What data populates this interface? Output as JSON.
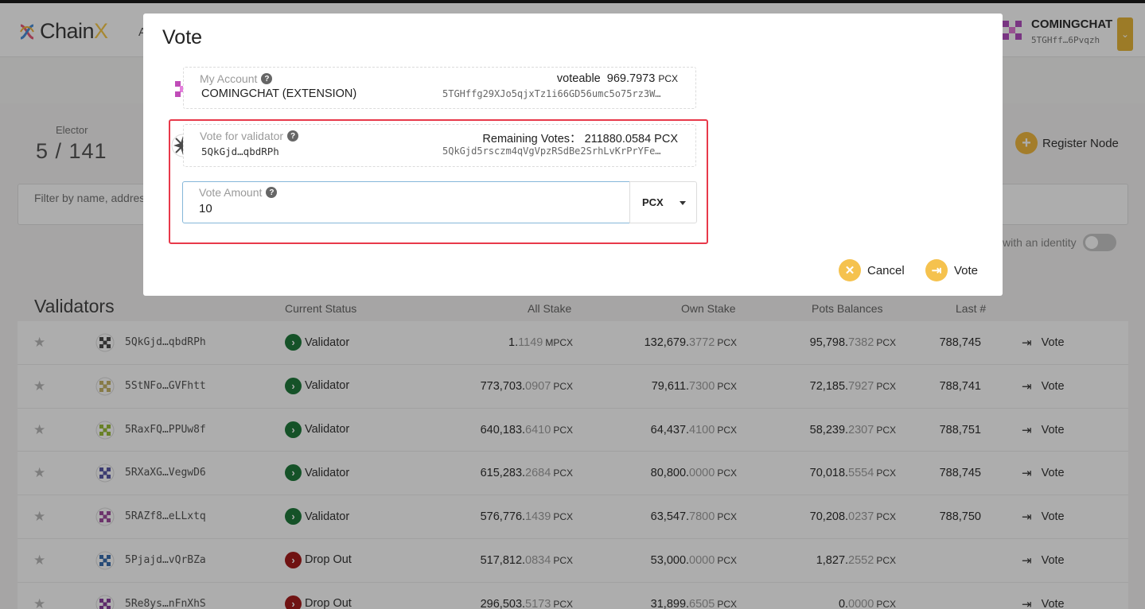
{
  "header": {
    "logo_text_a": "Chain",
    "logo_text_b": "X",
    "nav_peek": "A",
    "account_name": "COMINGCHAT",
    "account_addr": "5TGHff…6Pvqzh"
  },
  "summary": {
    "elector_label": "Elector",
    "elector_value": "5  /  141",
    "register_label": "Register Node"
  },
  "filter": {
    "placeholder": "Filter by name, address",
    "identity_label": "with an identity"
  },
  "validators": {
    "title": "Validators",
    "columns": {
      "status": "Current Status",
      "all_stake": "All Stake",
      "own_stake": "Own Stake",
      "pots": "Pots Balances",
      "last": "Last #"
    },
    "vote_label": "Vote",
    "rows": [
      {
        "name": "5QkGjd…qbdRPh",
        "status": "Validator",
        "all_int": "1.",
        "all_dec": "1149",
        "all_unit": "MPCX",
        "own_int": "132,679.",
        "own_dec": "3772",
        "own_unit": "PCX",
        "pot_int": "95,798.",
        "pot_dec": "7382",
        "pot_unit": "PCX",
        "last": "788,745"
      },
      {
        "name": "5StNFo…GVFhtt",
        "status": "Validator",
        "all_int": "773,703.",
        "all_dec": "0907",
        "all_unit": "PCX",
        "own_int": "79,611.",
        "own_dec": "7300",
        "own_unit": "PCX",
        "pot_int": "72,185.",
        "pot_dec": "7927",
        "pot_unit": "PCX",
        "last": "788,741"
      },
      {
        "name": "5RaxFQ…PPUw8f",
        "status": "Validator",
        "all_int": "640,183.",
        "all_dec": "6410",
        "all_unit": "PCX",
        "own_int": "64,437.",
        "own_dec": "4100",
        "own_unit": "PCX",
        "pot_int": "58,239.",
        "pot_dec": "2307",
        "pot_unit": "PCX",
        "last": "788,751"
      },
      {
        "name": "5RXaXG…VegwD6",
        "status": "Validator",
        "all_int": "615,283.",
        "all_dec": "2684",
        "all_unit": "PCX",
        "own_int": "80,800.",
        "own_dec": "0000",
        "own_unit": "PCX",
        "pot_int": "70,018.",
        "pot_dec": "5554",
        "pot_unit": "PCX",
        "last": "788,745"
      },
      {
        "name": "5RAZf8…eLLxtq",
        "status": "Validator",
        "all_int": "576,776.",
        "all_dec": "1439",
        "all_unit": "PCX",
        "own_int": "63,547.",
        "own_dec": "7800",
        "own_unit": "PCX",
        "pot_int": "70,208.",
        "pot_dec": "0237",
        "pot_unit": "PCX",
        "last": "788,750"
      },
      {
        "name": "5Pjajd…vQrBZa",
        "status": "Drop Out",
        "all_int": "517,812.",
        "all_dec": "0834",
        "all_unit": "PCX",
        "own_int": "53,000.",
        "own_dec": "0000",
        "own_unit": "PCX",
        "pot_int": "1,827.",
        "pot_dec": "2552",
        "pot_unit": "PCX",
        "last": ""
      },
      {
        "name": "5Re8ys…nFnXhS",
        "status": "Drop Out",
        "all_int": "296,503.",
        "all_dec": "5173",
        "all_unit": "PCX",
        "own_int": "31,899.",
        "own_dec": "6505",
        "own_unit": "PCX",
        "pot_int": "0.",
        "pot_dec": "0000",
        "pot_unit": "PCX",
        "last": ""
      }
    ]
  },
  "modal": {
    "title": "Vote",
    "account": {
      "label": "My Account",
      "name": "COMINGCHAT (EXTENSION)",
      "voteable_label": "voteable",
      "voteable_value": "969.7973",
      "voteable_unit": "PCX",
      "address": "5TGHffg29XJo5qjxTz1i66GD56umc5o75rz3W…"
    },
    "validator": {
      "label": "Vote for validator",
      "name": "5QkGjd…qbdRPh",
      "remaining_label": "Remaining Votes：",
      "remaining_value": "211880.0584 PCX",
      "address": "5QkGjd5rsczm4qVgVpzRSdBe2SrhLvKrPrYFe…"
    },
    "amount": {
      "label": "Vote Amount",
      "value": "10",
      "unit": "PCX"
    },
    "cancel_label": "Cancel",
    "vote_label": "Vote"
  },
  "colors": {
    "accent": "#f5c24e",
    "validator_status": "#1f7a3c",
    "dropout_status": "#a51d1d",
    "highlight": "#e8394a"
  }
}
